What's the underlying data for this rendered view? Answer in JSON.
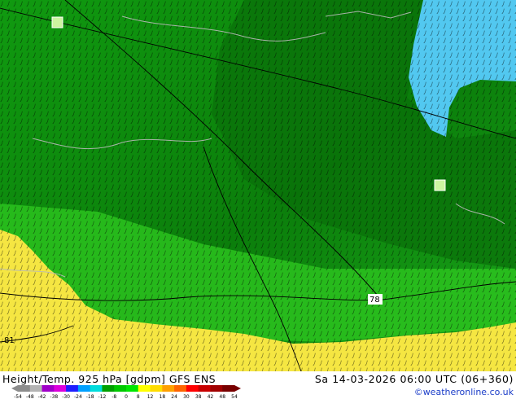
{
  "title": "Height/Temp. 925 hPa [gdpm] GFS ENS",
  "valid_time": "Sa 14-03-2026 06:00 UTC (06+360)",
  "credit": "©weatheronline.co.uk",
  "map": {
    "contour_labels": [
      "78",
      "81"
    ]
  },
  "legend": {
    "ticks": [
      "-54",
      "-48",
      "-42",
      "-38",
      "-30",
      "-24",
      "-18",
      "-12",
      "-8",
      "0",
      "8",
      "12",
      "18",
      "24",
      "30",
      "38",
      "42",
      "48",
      "54"
    ],
    "colors": [
      "#8c8c8c",
      "#b4b4b4",
      "#a000c8",
      "#dc00dc",
      "#1e1eff",
      "#00a0ff",
      "#00dcdc",
      "#00a000",
      "#00c800",
      "#00e600",
      "#ffff00",
      "#ffdc00",
      "#ffa000",
      "#ff6400",
      "#ff0000",
      "#c80000",
      "#a00000",
      "#780000"
    ]
  },
  "colors": {
    "cold_cyan": "#52c8f0",
    "dark_green": "#0a7a0a",
    "mid_green": "#15a515",
    "bright_green": "#33cc22",
    "warm_yellow": "#f5e642",
    "city_marker": "#ccf5a0"
  }
}
